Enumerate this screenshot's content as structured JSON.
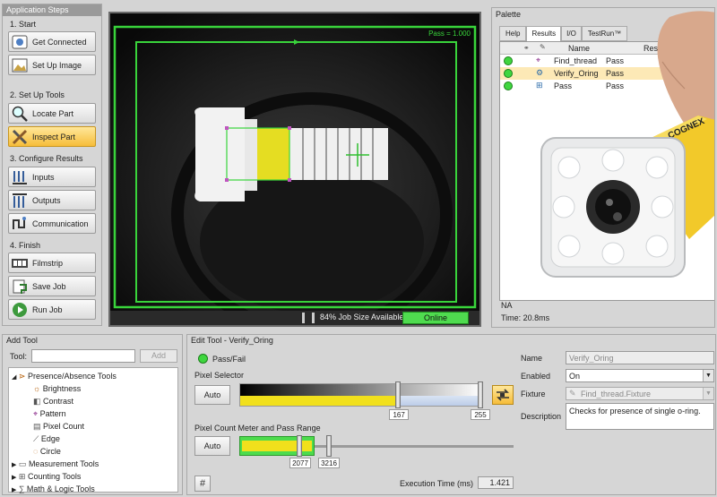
{
  "steps": {
    "title": "Application Steps",
    "s1": "1. Start",
    "get_connected": "Get Connected",
    "set_up_image": "Set Up Image",
    "s2": "2. Set Up Tools",
    "locate_part": "Locate Part",
    "inspect_part": "Inspect Part",
    "s3": "3. Configure Results",
    "inputs": "Inputs",
    "outputs": "Outputs",
    "communication": "Communication",
    "s4": "4. Finish",
    "filmstrip": "Filmstrip",
    "save_job": "Save Job",
    "run_job": "Run Job"
  },
  "image": {
    "pass_label": "Pass = 1.000",
    "job_size": "84% Job Size Available",
    "status": "Online"
  },
  "palette": {
    "title": "Palette",
    "tabs": [
      "Help",
      "Results",
      "I/O",
      "TestRun™"
    ],
    "columns": {
      "name": "Name",
      "result": "Result"
    },
    "rows": [
      {
        "name": "Find_thread",
        "result": "Pass"
      },
      {
        "name": "Verify_Oring",
        "result": "Pass"
      },
      {
        "name": "Pass",
        "result": "Pass"
      }
    ],
    "na": "NA",
    "time": "Time: 20.8ms",
    "camera_brand": "COGNEX"
  },
  "add_tool": {
    "title": "Add Tool",
    "tool_label": "Tool:",
    "add_button": "Add",
    "tree": {
      "presence": "Presence/Absence Tools",
      "children": [
        "Brightness",
        "Contrast",
        "Pattern",
        "Pixel Count",
        "Edge",
        "Circle"
      ],
      "measurement": "Measurement Tools",
      "counting": "Counting Tools",
      "math": "Math & Logic Tools"
    }
  },
  "edit_tool": {
    "title": "Edit Tool - Verify_Oring",
    "pass_fail": "Pass/Fail",
    "pixel_selector": "Pixel Selector",
    "auto": "Auto",
    "sel_low": "167",
    "sel_high": "255",
    "sel_low_value": 167,
    "sel_high_value": 255,
    "sel_max": 255,
    "meter_label": "Pixel Count Meter and Pass Range",
    "range_low": "2077",
    "range_high": "3216",
    "exec_label": "Execution Time (ms)",
    "exec_value": "1.421"
  },
  "props": {
    "name_label": "Name",
    "name_value": "Verify_Oring",
    "enabled_label": "Enabled",
    "enabled_value": "On",
    "fixture_label": "Fixture",
    "fixture_value": "Find_thread.Fixture",
    "description_label": "Description",
    "description_value": "Checks for presence of single o-ring."
  },
  "colors": {
    "pass_green": "#39d43b",
    "accent_yellow": "#f1e01c",
    "active_orange": "#f6bd3a"
  }
}
